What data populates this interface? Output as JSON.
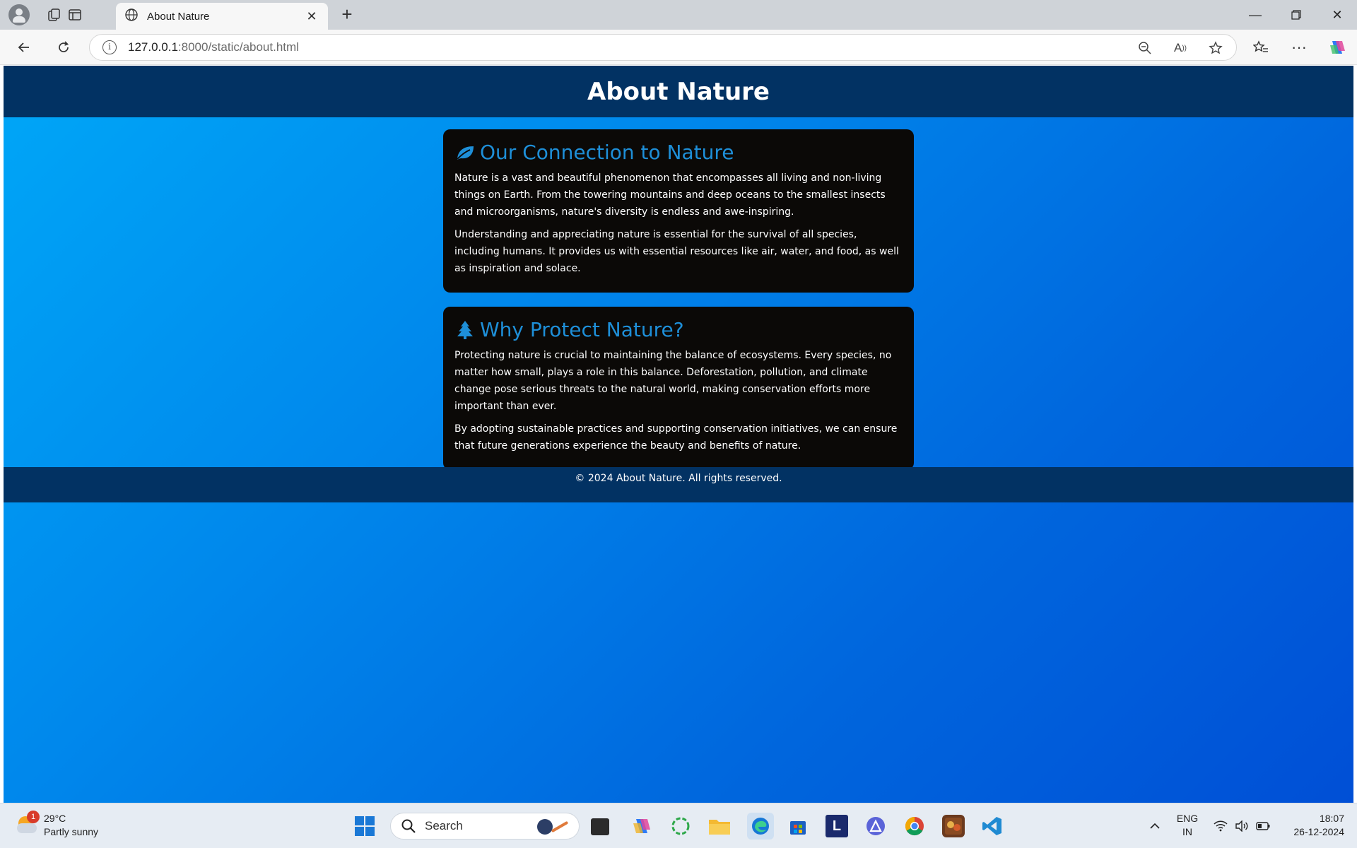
{
  "browser": {
    "tab_title": "About Nature",
    "url_host": "127.0.0.1",
    "url_rest": ":8000/static/about.html"
  },
  "page": {
    "header_title": "About Nature",
    "sections": [
      {
        "icon": "leaf-icon",
        "heading": "Our Connection to Nature",
        "paragraphs": [
          "Nature is a vast and beautiful phenomenon that encompasses all living and non-living things on Earth. From the towering mountains and deep oceans to the smallest insects and microorganisms, nature's diversity is endless and awe-inspiring.",
          "Understanding and appreciating nature is essential for the survival of all species, including humans. It provides us with essential resources like air, water, and food, as well as inspiration and solace."
        ]
      },
      {
        "icon": "tree-icon",
        "heading": "Why Protect Nature?",
        "paragraphs": [
          "Protecting nature is crucial to maintaining the balance of ecosystems. Every species, no matter how small, plays a role in this balance. Deforestation, pollution, and climate change pose serious threats to the natural world, making conservation efforts more important than ever.",
          "By adopting sustainable practices and supporting conservation initiatives, we can ensure that future generations experience the beauty and benefits of nature."
        ]
      }
    ],
    "footer_text": "© 2024 About Nature. All rights reserved."
  },
  "colors": {
    "header_bg": "#023263",
    "card_bg": "#0b0907",
    "heading": "#1e8fd8",
    "gradient_start": "#00a7f7",
    "gradient_end": "#004fd6"
  },
  "taskbar": {
    "weather_temp": "29°C",
    "weather_desc": "Partly sunny",
    "weather_badge": "1",
    "search_label": "Search",
    "lang_top": "ENG",
    "lang_bottom": "IN",
    "time": "18:07",
    "date": "26-12-2024",
    "apps": [
      "file-explorer-icon",
      "copilot-icon",
      "refresh-app-icon",
      "folder-icon",
      "edge-icon",
      "store-icon",
      "l-app-icon",
      "triangle-app-icon",
      "chrome-icon",
      "game-app-icon",
      "vscode-icon"
    ]
  }
}
